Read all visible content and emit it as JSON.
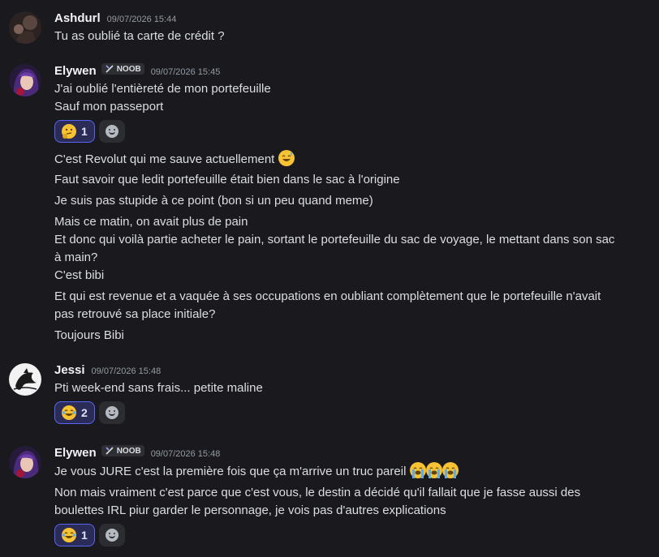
{
  "messages": [
    {
      "author": "Ashdurl",
      "timestamp": "09/07/2026 15:44",
      "lines": [
        "Tu as oublié ta carte de crédit ?"
      ]
    },
    {
      "author": "Elywen",
      "badge": "NOOB",
      "timestamp": "09/07/2026 15:45",
      "lines": [
        "J'ai oublié l'entièreté de mon portefeuille",
        "Sauf mon passeport",
        "C'est Revolut qui me sauve actuellement",
        "Faut savoir que ledit portefeuille était bien dans le sac à l'origine",
        "Je suis pas stupide à ce point (bon si un peu quand meme)",
        "Mais ce matin, on avait plus de pain",
        "Et donc qui voilà partie acheter le pain, sortant le portefeuille du sac de voyage, le mettant dans son sac",
        "à main?",
        "C'est bibi",
        "Et qui est revenue et a vaquée à ses occupations en oubliant complètement que le portefeuille n'avait",
        "pas retrouvé sa place initiale?",
        "Toujours Bibi"
      ],
      "reaction": {
        "emoji": "thinking-face",
        "count": "1"
      }
    },
    {
      "author": "Jessi",
      "timestamp": "09/07/2026 15:48",
      "lines": [
        "Pti week-end sans frais... petite maline"
      ],
      "reaction": {
        "emoji": "tears-of-joy",
        "count": "2"
      }
    },
    {
      "author": "Elywen",
      "badge": "NOOB",
      "timestamp": "09/07/2026 15:48",
      "lines": [
        "Je vous JURE c'est la première fois que ça m'arrive un truc pareil",
        "Non mais vraiment c'est parce que c'est vous, le destin a décidé qu'il fallait que je fasse aussi des",
        "boulettes IRL piur garder le personnage, je vois pas d'autres explications"
      ],
      "reaction": {
        "emoji": "tears-of-joy",
        "count": "1"
      }
    }
  ],
  "icons": {
    "sweat_emoji": "grinning-sweat-emoji",
    "cry_emoji": "loudly-crying-emoji",
    "badge_icon": "crossed-swords-icon",
    "add_reaction": "smiley-add-reaction-icon"
  },
  "colors": {
    "background": "#1a1a1e",
    "reaction_bg": "#2a2c57",
    "reaction_border": "#5865f2",
    "text": "#dbdee1",
    "timestamp": "#949ba4"
  }
}
